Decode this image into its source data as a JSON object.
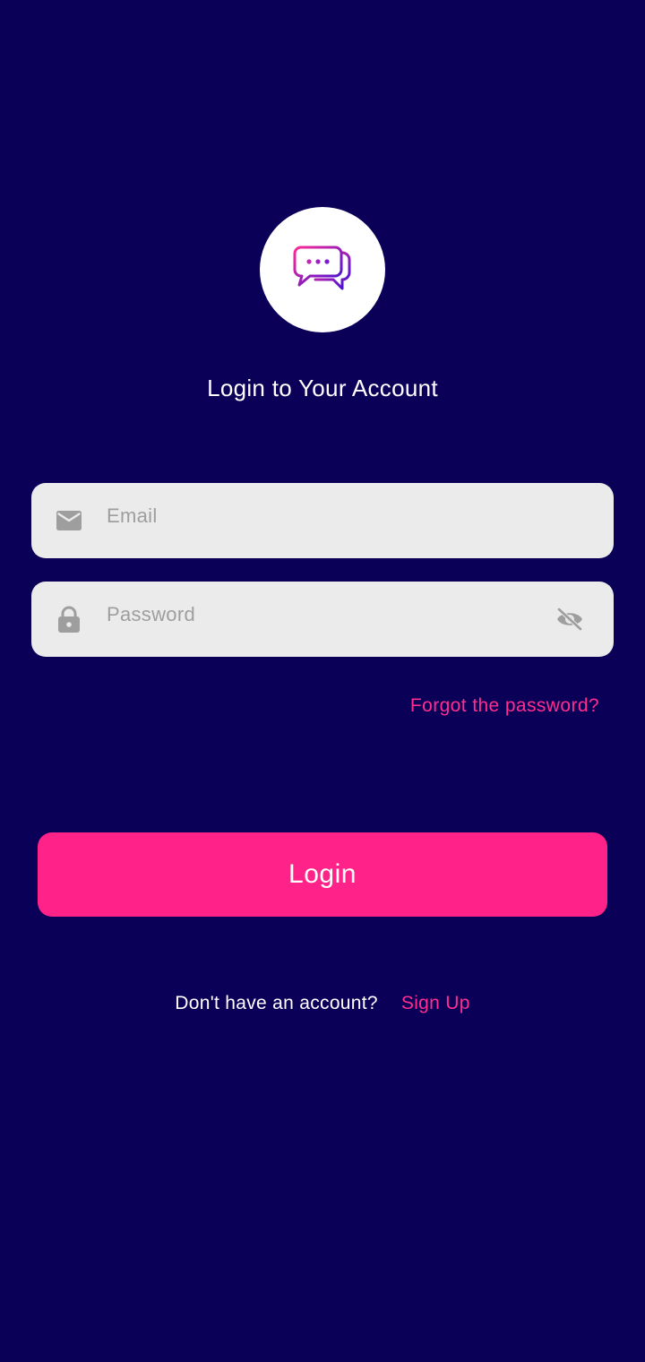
{
  "logo": {
    "icon": "chat-bubbles-icon"
  },
  "title": "Login to Your Account",
  "email_field": {
    "placeholder": "Email",
    "icon": "mail-icon"
  },
  "password_field": {
    "placeholder": "Password",
    "icon": "lock-icon",
    "toggle_icon": "eye-off-icon"
  },
  "forgot_link": "Forgot the password?",
  "login_button": "Login",
  "signup": {
    "question": "Don't have an account?",
    "link": "Sign Up"
  },
  "colors": {
    "background": "#0a0058",
    "accent": "#ff2288",
    "field_bg": "#ebebeb",
    "icon_gray": "#9e9e9e"
  }
}
